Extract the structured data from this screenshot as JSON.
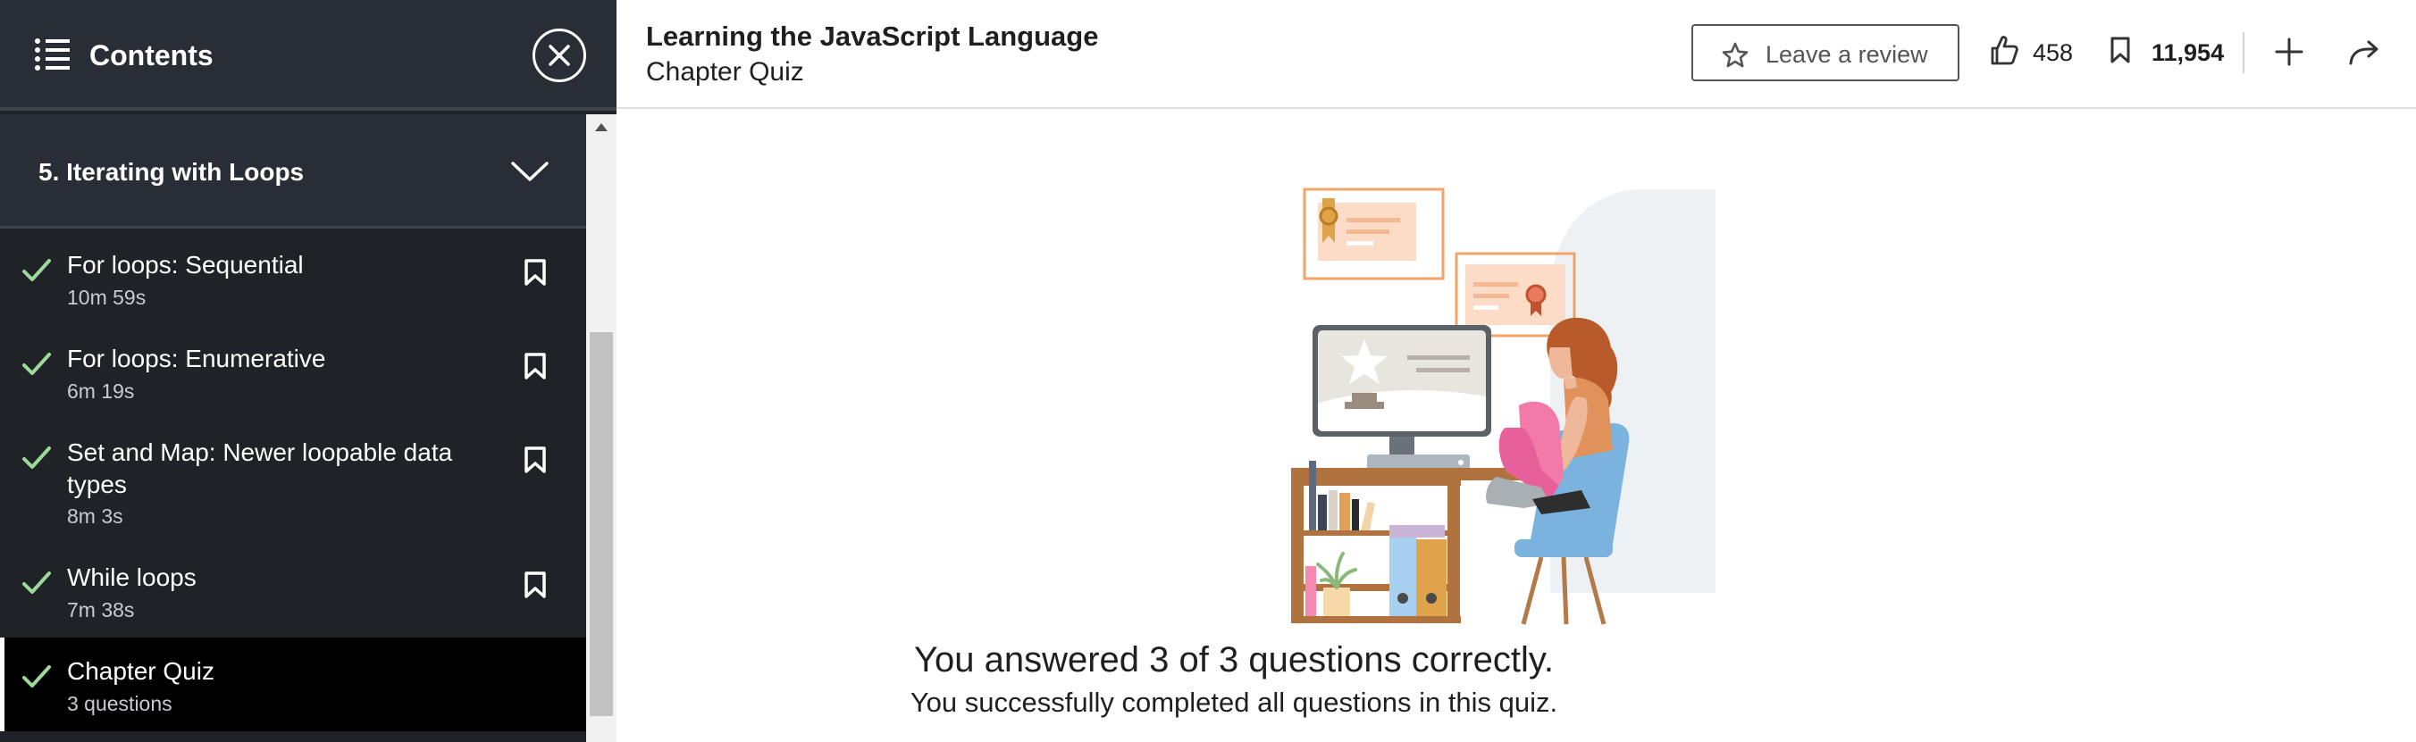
{
  "sidebar": {
    "title": "Contents",
    "section": {
      "title": "5. Iterating with Loops",
      "expanded": true
    },
    "items": [
      {
        "title": "For loops: Sequential",
        "meta": "10m 59s",
        "completed": true,
        "active": false
      },
      {
        "title": "For loops: Enumerative",
        "meta": "6m 19s",
        "completed": true,
        "active": false
      },
      {
        "title": "Set and Map: Newer loopable data types",
        "meta": "8m 3s",
        "completed": true,
        "active": false
      },
      {
        "title": "While loops",
        "meta": "7m 38s",
        "completed": true,
        "active": false
      },
      {
        "title": "Chapter Quiz",
        "meta": "3 questions",
        "completed": true,
        "active": true
      }
    ]
  },
  "header": {
    "course_title": "Learning the JavaScript Language",
    "chapter_title": "Chapter Quiz",
    "review_label": "Leave a review",
    "likes": "458",
    "saves": "11,954"
  },
  "main": {
    "result_title": "You answered 3 of 3 questions correctly.",
    "result_subtitle": "You successfully completed all questions in this quiz."
  },
  "icons": {
    "menu": "list-icon",
    "close": "close-icon",
    "section_toggle": "chevron-down-icon",
    "completed": "checkmark-icon",
    "bookmark": "bookmark-icon",
    "review": "star-icon",
    "like": "thumbs-up-icon",
    "save": "bookmark-icon",
    "add": "plus-icon",
    "share": "share-arrow-icon"
  },
  "colors": {
    "sidebar_bg": "#1f2328",
    "sidebar_header_bg": "#292e36",
    "active_item_bg": "#000000",
    "check_green": "#9fd89b",
    "text_dark": "#1f1f1f"
  }
}
